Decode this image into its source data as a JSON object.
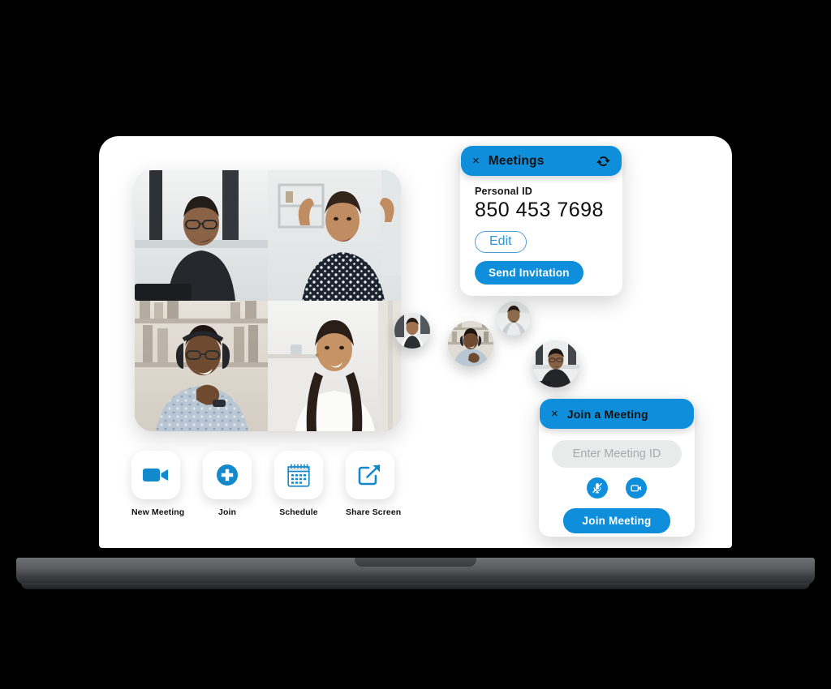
{
  "app": {
    "title": "Zoom meeting app mockup on laptop",
    "accent_color": "#0f8fdb",
    "screen_background": "#ffffff",
    "backdrop_color": "#000000",
    "laptop_base_color": "#595b5f"
  },
  "meetings_panel": {
    "close_label": "×",
    "title": "Meetings",
    "sync_icon": "sync-icon",
    "personal_id_label": "Personal ID",
    "personal_id_value": "850 453 7698",
    "edit_label": "Edit",
    "send_invitation_label": "Send Invitation"
  },
  "join_panel": {
    "close_label": "×",
    "title": "Join a Meeting",
    "meeting_id_value": "",
    "meeting_id_placeholder": "Enter Meeting ID",
    "mic_icon": "microphone-muted-icon",
    "video_icon": "video-camera-icon",
    "join_label": "Join Meeting"
  },
  "toolbar": {
    "items": [
      {
        "label": "New Meeting",
        "icon": "video-camera-icon"
      },
      {
        "label": "Join",
        "icon": "plus-circle-icon"
      },
      {
        "label": "Schedule",
        "icon": "calendar-icon"
      },
      {
        "label": "Share Screen",
        "icon": "share-screen-icon"
      }
    ]
  },
  "video_grid": {
    "participants": [
      {
        "position": "top-left",
        "description": "Man with glasses in dark shirt at laptop"
      },
      {
        "position": "top-right",
        "description": "Woman in polka dot blouse gesturing"
      },
      {
        "position": "bottom-left",
        "description": "Man with headset in patterned shirt"
      },
      {
        "position": "bottom-right",
        "description": "Woman in white top smiling"
      }
    ]
  },
  "floating_avatars": [
    {
      "id": "avatar-1",
      "description": "Participant thumbnail"
    },
    {
      "id": "avatar-2",
      "description": "Participant thumbnail"
    },
    {
      "id": "avatar-3",
      "description": "Participant thumbnail"
    },
    {
      "id": "avatar-4",
      "description": "Participant thumbnail"
    }
  ]
}
